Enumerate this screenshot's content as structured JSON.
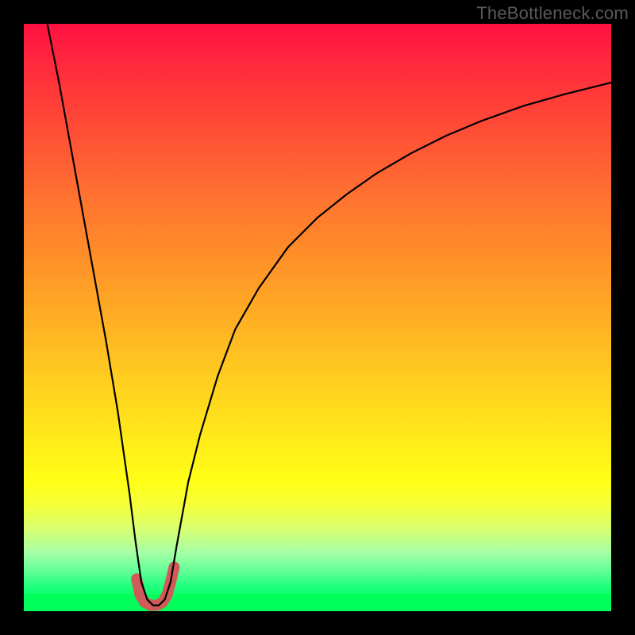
{
  "watermark": {
    "text": "TheBottleneck.com"
  },
  "chart_data": {
    "type": "line",
    "title": "",
    "xlabel": "",
    "ylabel": "",
    "xlim": [
      0,
      100
    ],
    "ylim": [
      0,
      100
    ],
    "grid": false,
    "legend": false,
    "annotations": [],
    "background_gradient": {
      "orientation": "vertical",
      "stops": [
        {
          "pos": 0,
          "color": "#ff1041"
        },
        {
          "pos": 22,
          "color": "#ff5a34"
        },
        {
          "pos": 46,
          "color": "#ffa226"
        },
        {
          "pos": 70,
          "color": "#ffe81a"
        },
        {
          "pos": 86,
          "color": "#d8ff72"
        },
        {
          "pos": 100,
          "color": "#00ff5a"
        }
      ]
    },
    "series": [
      {
        "name": "bottleneck-curve",
        "color": "#000000",
        "x": [
          4,
          6,
          8,
          10,
          12,
          14,
          16,
          18,
          19,
          20,
          21,
          22,
          23,
          24,
          25,
          26,
          28,
          30,
          33,
          36,
          40,
          45,
          50,
          55,
          60,
          66,
          72,
          78,
          85,
          92,
          100
        ],
        "y": [
          100,
          90,
          79,
          68,
          57,
          46,
          34,
          20,
          12,
          5,
          2,
          1,
          1,
          2,
          5,
          11,
          22,
          30,
          40,
          48,
          55,
          62,
          67,
          71,
          74.5,
          78,
          81,
          83.5,
          86,
          88,
          90
        ]
      },
      {
        "name": "valley-highlight",
        "color": "#d05a5a",
        "stroke_width_px": 14,
        "x": [
          19.2,
          19.8,
          20.6,
          21.6,
          22.6,
          23.6,
          24.4,
          25.0,
          25.6
        ],
        "y": [
          5.5,
          2.8,
          1.5,
          1.0,
          1.0,
          1.5,
          2.8,
          5.0,
          7.5
        ]
      }
    ]
  }
}
